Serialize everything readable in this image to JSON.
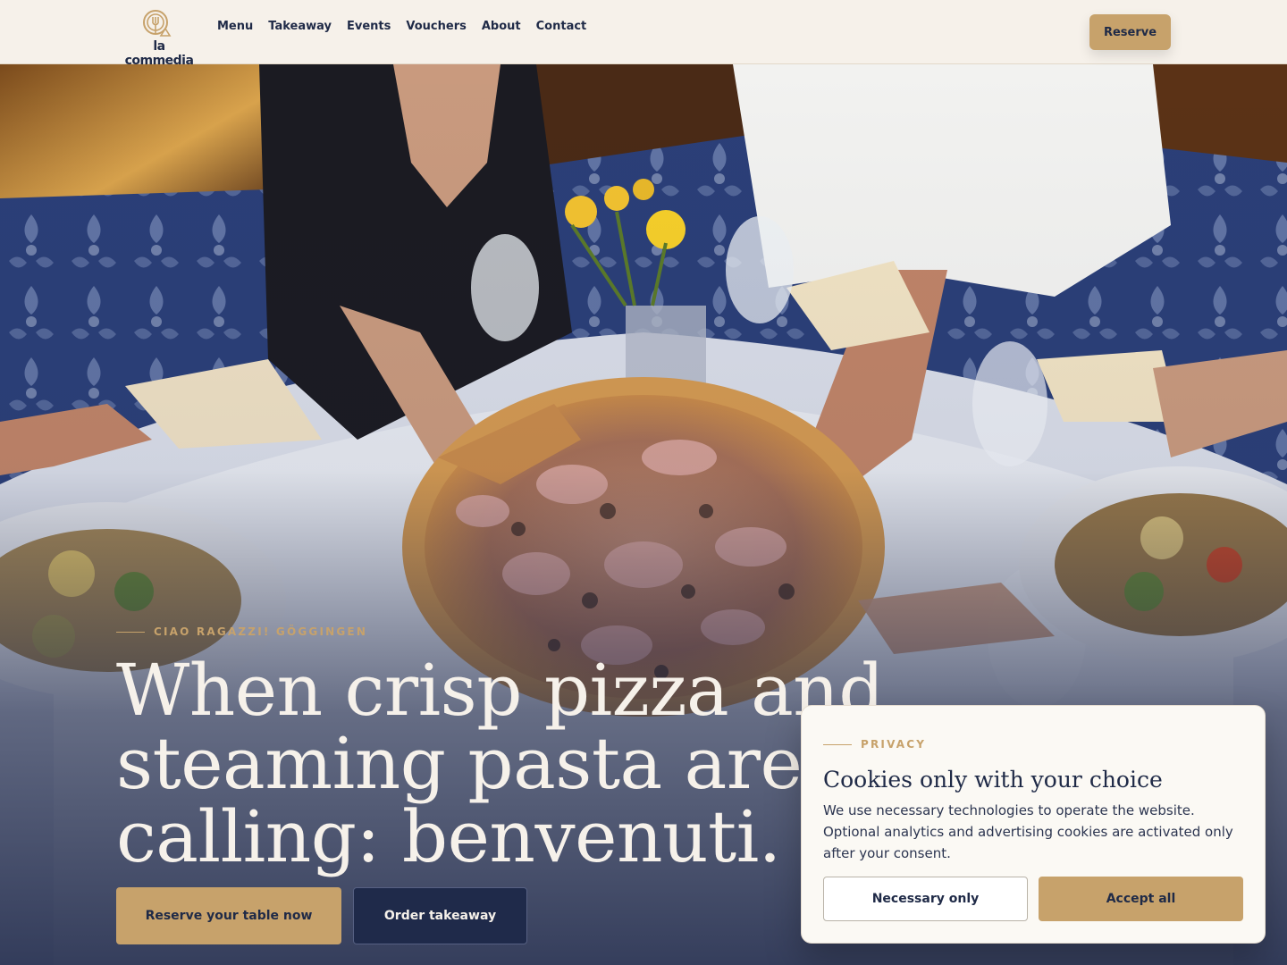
{
  "header": {
    "logo_text": "la commedia",
    "nav": [
      "Menu",
      "Takeaway",
      "Events",
      "Vouchers",
      "About",
      "Contact"
    ],
    "reserve_label": "Reserve"
  },
  "hero": {
    "eyebrow": "CIAO RAGAZZI! GÖGGINGEN",
    "headline_lines": [
      "When crisp pizza and",
      "steaming pasta are",
      "calling: benvenuti."
    ],
    "cta_primary": "Reserve your table now",
    "cta_secondary": "Order takeaway",
    "image_description": "Guests sharing a ham and mushroom pizza at a white-clothed table in a blue upholstered booth"
  },
  "cookie_banner": {
    "eyebrow": "PRIVACY",
    "title": "Cookies only with your choice",
    "body": "We use necessary technologies to operate the website. Optional analytics and advertising cookies are activated only after your consent.",
    "necessary_label": "Necessary only",
    "accept_label": "Accept all"
  },
  "colors": {
    "gold": "#c7a26b",
    "navy": "#1f2a47",
    "cream": "#f6f1ea"
  }
}
